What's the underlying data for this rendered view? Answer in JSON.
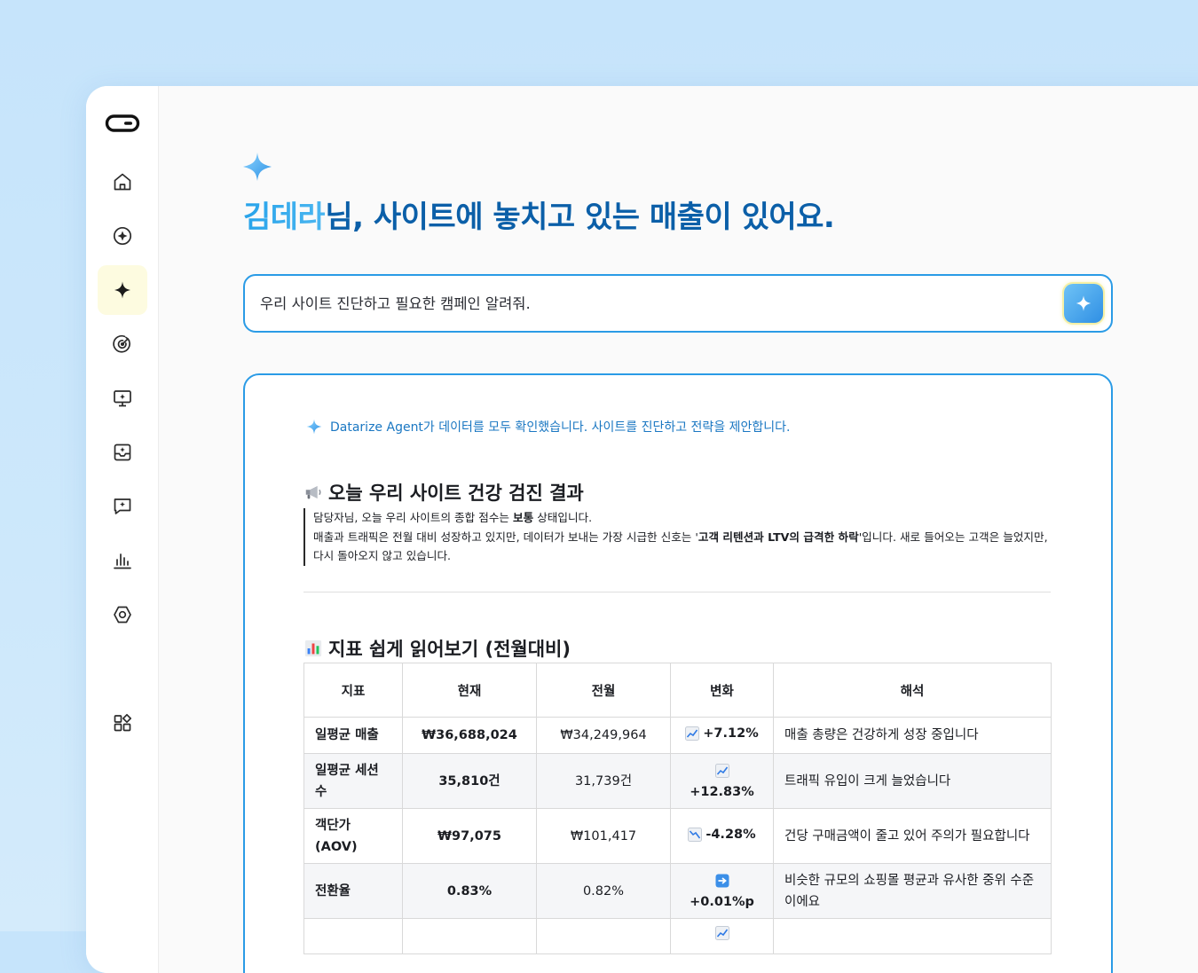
{
  "sidebar": {
    "items": [
      {
        "icon": "home-icon"
      },
      {
        "icon": "compass-icon"
      },
      {
        "icon": "sparkle-icon",
        "active": true
      },
      {
        "icon": "target-icon"
      },
      {
        "icon": "monitor-sparkle-icon"
      },
      {
        "icon": "inbox-sparkle-icon"
      },
      {
        "icon": "chat-sparkle-icon"
      },
      {
        "icon": "bar-chart-icon"
      },
      {
        "icon": "hexagon-settings-icon"
      },
      {
        "icon": "apps-grid-icon"
      }
    ]
  },
  "header": {
    "name": "김데라",
    "title_rest": "님, 사이트에 놓치고 있는 매출이 있어요."
  },
  "prompt": {
    "value": "우리 사이트 진단하고 필요한 캠페인 알려줘."
  },
  "result": {
    "agent_status": "Datarize Agent가 데이터를 모두 확인했습니다. 사이트를 진단하고 전략을 제안합니다.",
    "section1_title": "오늘 우리 사이트 건강 검진 결과",
    "summary_line1_pre": "담당자님, 오늘 우리 사이트의 종합 점수는 ",
    "summary_line1_bold": "보통",
    "summary_line1_post": " 상태입니다.",
    "summary_line2_pre": "매출과 트래픽은 전월 대비 성장하고 있지만, 데이터가 보내는 가장 시급한 신호는 '",
    "summary_line2_bold": "고객 리텐션과 LTV의 급격한 하락",
    "summary_line2_post": "'입니다. 새로 들어오는 고객은 늘었지만, 다시 돌아오지 않고 있습니다.",
    "section2_title": "지표 쉽게 읽어보기 (전월대비)",
    "table": {
      "headers": [
        "지표",
        "현재",
        "전월",
        "변화",
        "해석"
      ],
      "rows": [
        {
          "metric": "일평균 매출",
          "current": "₩36,688,024",
          "previous": "₩34,249,964",
          "change_icon": "trend-up",
          "change": "+7.12%",
          "note": "매출 총량은 건강하게 성장 중입니다"
        },
        {
          "metric": "일평균 세션 수",
          "current": "35,810건",
          "previous": "31,739건",
          "change_icon": "trend-up",
          "change": "+12.83%",
          "note": "트래픽 유입이 크게 늘었습니다"
        },
        {
          "metric": "객단가 (AOV)",
          "current": "₩97,075",
          "previous": "₩101,417",
          "change_icon": "trend-down",
          "change": "-4.28%",
          "note": "건당 구매금액이 줄고 있어 주의가 필요합니다"
        },
        {
          "metric": "전환율",
          "current": "0.83%",
          "previous": "0.82%",
          "change_icon": "arrow-right",
          "change": "+0.01%p",
          "note": "비슷한 규모의 쇼핑몰 평균과 유사한 중위 수준이에요"
        }
      ]
    }
  }
}
